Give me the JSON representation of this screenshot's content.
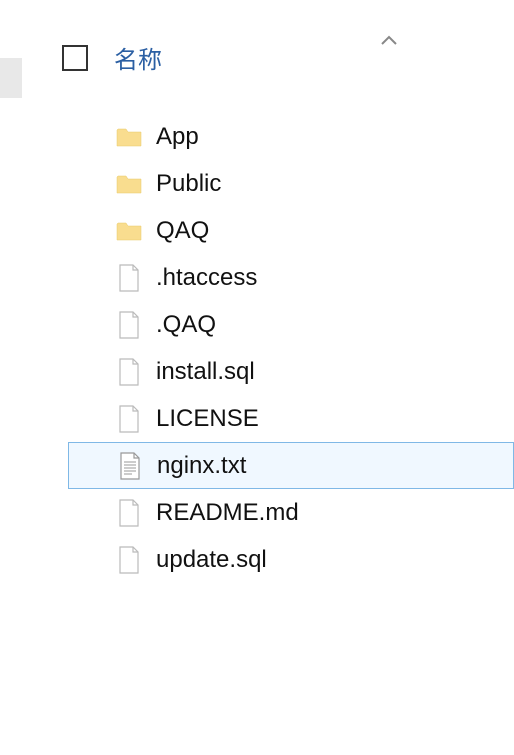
{
  "header": {
    "column_name": "名称"
  },
  "items": [
    {
      "name": "App",
      "type": "folder",
      "selected": false
    },
    {
      "name": "Public",
      "type": "folder",
      "selected": false
    },
    {
      "name": "QAQ",
      "type": "folder",
      "selected": false
    },
    {
      "name": ".htaccess",
      "type": "file",
      "selected": false
    },
    {
      "name": ".QAQ",
      "type": "file",
      "selected": false
    },
    {
      "name": "install.sql",
      "type": "file",
      "selected": false
    },
    {
      "name": "LICENSE",
      "type": "file",
      "selected": false
    },
    {
      "name": "nginx.txt",
      "type": "textfile",
      "selected": true
    },
    {
      "name": "README.md",
      "type": "file",
      "selected": false
    },
    {
      "name": "update.sql",
      "type": "file",
      "selected": false
    }
  ]
}
